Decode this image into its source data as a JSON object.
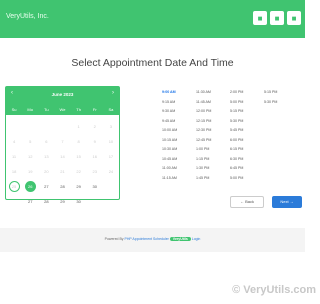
{
  "header": {
    "brand": "VeryUtils, Inc.",
    "buttons": [
      "■",
      "■",
      "■"
    ]
  },
  "page": {
    "title": "Select Appointment Date And Time"
  },
  "calendar": {
    "month_label": "June 2023",
    "prev": "‹",
    "next": "›",
    "dows": [
      "Su",
      "Mo",
      "Tu",
      "We",
      "Th",
      "Fr",
      "Sa"
    ],
    "rows": [
      [
        {
          "d": ""
        },
        {
          "d": ""
        },
        {
          "d": ""
        },
        {
          "d": ""
        },
        {
          "d": "1"
        },
        {
          "d": "2"
        },
        {
          "d": "3"
        }
      ],
      [
        {
          "d": "4"
        },
        {
          "d": "5"
        },
        {
          "d": "6"
        },
        {
          "d": "7"
        },
        {
          "d": "8"
        },
        {
          "d": "9"
        },
        {
          "d": "10"
        }
      ],
      [
        {
          "d": "11"
        },
        {
          "d": "12"
        },
        {
          "d": "13"
        },
        {
          "d": "14"
        },
        {
          "d": "15"
        },
        {
          "d": "16"
        },
        {
          "d": "17"
        }
      ],
      [
        {
          "d": "18"
        },
        {
          "d": "19"
        },
        {
          "d": "20"
        },
        {
          "d": "21"
        },
        {
          "d": "22"
        },
        {
          "d": "23"
        },
        {
          "d": "24"
        }
      ],
      [
        {
          "d": "25",
          "state": "today"
        },
        {
          "d": "26",
          "state": "sel"
        },
        {
          "d": "27",
          "state": "avail"
        },
        {
          "d": "28",
          "state": "avail"
        },
        {
          "d": "29",
          "state": "avail"
        },
        {
          "d": "30",
          "state": "avail"
        },
        {
          "d": ""
        }
      ],
      [
        {
          "d": ""
        },
        {
          "d": "27",
          "state": "avail"
        },
        {
          "d": "28",
          "state": "avail"
        },
        {
          "d": "29",
          "state": "avail"
        },
        {
          "d": "30",
          "state": "avail"
        },
        {
          "d": ""
        },
        {
          "d": ""
        }
      ]
    ]
  },
  "time_slots": {
    "columns": [
      [
        "9:00 AM",
        "9:15 AM",
        "9:30 AM",
        "9:45 AM",
        "10:00 AM",
        "10:15 AM",
        "10:30 AM",
        "10:45 AM",
        "11:00 AM",
        "11:15 AM"
      ],
      [
        "11:30 AM",
        "11:45 AM",
        "12:00 PM",
        "12:15 PM",
        "12:30 PM",
        "12:45 PM",
        "1:00 PM",
        "1:15 PM",
        "1:30 PM",
        "1:45 PM"
      ],
      [
        "2:00 PM",
        "5:00 PM",
        "5:15 PM",
        "5:30 PM",
        "5:45 PM",
        "6:00 PM",
        "6:15 PM",
        "6:30 PM",
        "6:45 PM",
        "5:00 PM"
      ],
      [
        "5:15 PM",
        "5:30 PM",
        "",
        "",
        "",
        "",
        "",
        "",
        "",
        ""
      ]
    ],
    "selected": "9:00 AM"
  },
  "actions": {
    "back": "← Back",
    "next": "Next →"
  },
  "footer": {
    "powered_prefix": "Powered By",
    "product": "PHP Appointment Scheduler",
    "badge": "VeryUtils",
    "suffix": "Login"
  },
  "watermark": "© VeryUtils.com"
}
